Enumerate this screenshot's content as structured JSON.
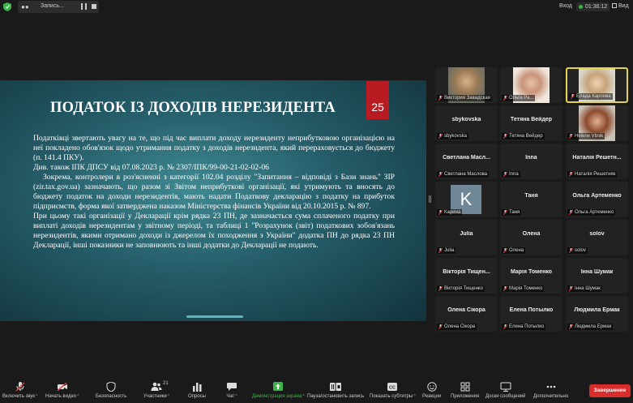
{
  "topbar": {
    "recording_label": "Запись...",
    "login_label": "Вход",
    "timer": "01:36:12",
    "view_label": "Вид"
  },
  "slide": {
    "title": "ПОДАТОК ІЗ ДОХОДІВ НЕРЕЗИДЕНТА",
    "page_number": "25",
    "paragraphs": [
      "Податківці звертають увагу на те, що під час виплати доходу нерезиденту неприбутковою організацією на неї покладено обов'язок щодо утримання податку з доходів нерезидента, який перераховується до бюджету (п. 141.4 ПКУ).",
      "Див. також ІПК ДПСУ від  07.08.2023 р. № 2307/ІПК/99-00-21-02-02-06",
      "Зокрема, контролери в роз'ясненні з категорії 102.04 розділу \"Запитання – відповіді з Бази знань\" ЗІР (zir.tax.gov.ua) зазначають, що разом зі Звітом неприбуткові організації, які утримують та вносять до бюджету податок на доходи нерезидентів, мають надати Податкову декларацію з податку на прибуток підприємств, форма якої затверджена наказом Міністерства фінансів України від 20.10.2015 р. № 897.",
      "При цьому такі організації у Декларації крім рядка 23 ПН, де зазначається сума сплаченого податку при виплаті доходів нерезидентам у звітному періоді, та таблиці 1 \"Розрахунок (звіт) податкових зобов'язань нерезидентів, якими отримано доходи із джерелом їх походження з України\" додатка ПН до рядка 23 ПН Декларації, інші показники не заповнюють та інші додатки до Декларації не подають."
    ]
  },
  "participants": [
    {
      "name": "",
      "label": "Виктория Завадская",
      "video": true
    },
    {
      "name": "",
      "label": "Ольга Ра...",
      "video": true
    },
    {
      "name": "",
      "label": "Елада Карпова",
      "video": true,
      "active": true
    },
    {
      "name": "sbykovska",
      "label": "sbykovska"
    },
    {
      "name": "Тетяна Вейдер",
      "label": "Тетяна Вейдер"
    },
    {
      "name": "",
      "label": "Helene Vitnik",
      "video": true
    },
    {
      "name": "Светлана Масл...",
      "label": "Светлана Маслова"
    },
    {
      "name": "Inna",
      "label": "Inna"
    },
    {
      "name": "Наталія Решетн...",
      "label": "Наталія Решетняк"
    },
    {
      "name": "",
      "label": "Карина",
      "avatar": "K"
    },
    {
      "name": "Таня",
      "label": "Таня"
    },
    {
      "name": "Ольга Артеменко",
      "label": "Ольга Артеменко"
    },
    {
      "name": "Julia",
      "label": "Julia"
    },
    {
      "name": "Олена",
      "label": "Олена"
    },
    {
      "name": "solov",
      "label": "solov"
    },
    {
      "name": "Вікторія Тищен...",
      "label": "Вікторія Тищенко"
    },
    {
      "name": "Марія Томенко",
      "label": "Марія Томенко"
    },
    {
      "name": "Інна Шумак",
      "label": "Інна Шумак"
    },
    {
      "name": "Олена Сікора",
      "label": "Олена Сікора"
    },
    {
      "name": "Елена Потылко",
      "label": "Елена Потылко"
    },
    {
      "name": "Людмила Ермак",
      "label": "Людмила Ермак"
    }
  ],
  "toolbar": {
    "unmute": "Включить звук",
    "start_video": "Начать видео",
    "security": "Безопасность",
    "participants": "Участники",
    "participants_count": "21",
    "polls": "Опросы",
    "chat": "Чат",
    "share_screen": "Демонстрация экрана",
    "pause_recording": "Пауза/остановить запись",
    "captions": "Показать субтитры",
    "reactions": "Реакции",
    "apps": "Приложения",
    "whiteboards": "Доски сообщений",
    "more": "Дополнительно",
    "end": "Завершение"
  },
  "colors": {
    "share_green": "#3bb54a",
    "end_red": "#d92d2d",
    "active_border": "#e5d44a",
    "slide_number_bg": "#b81c22"
  }
}
